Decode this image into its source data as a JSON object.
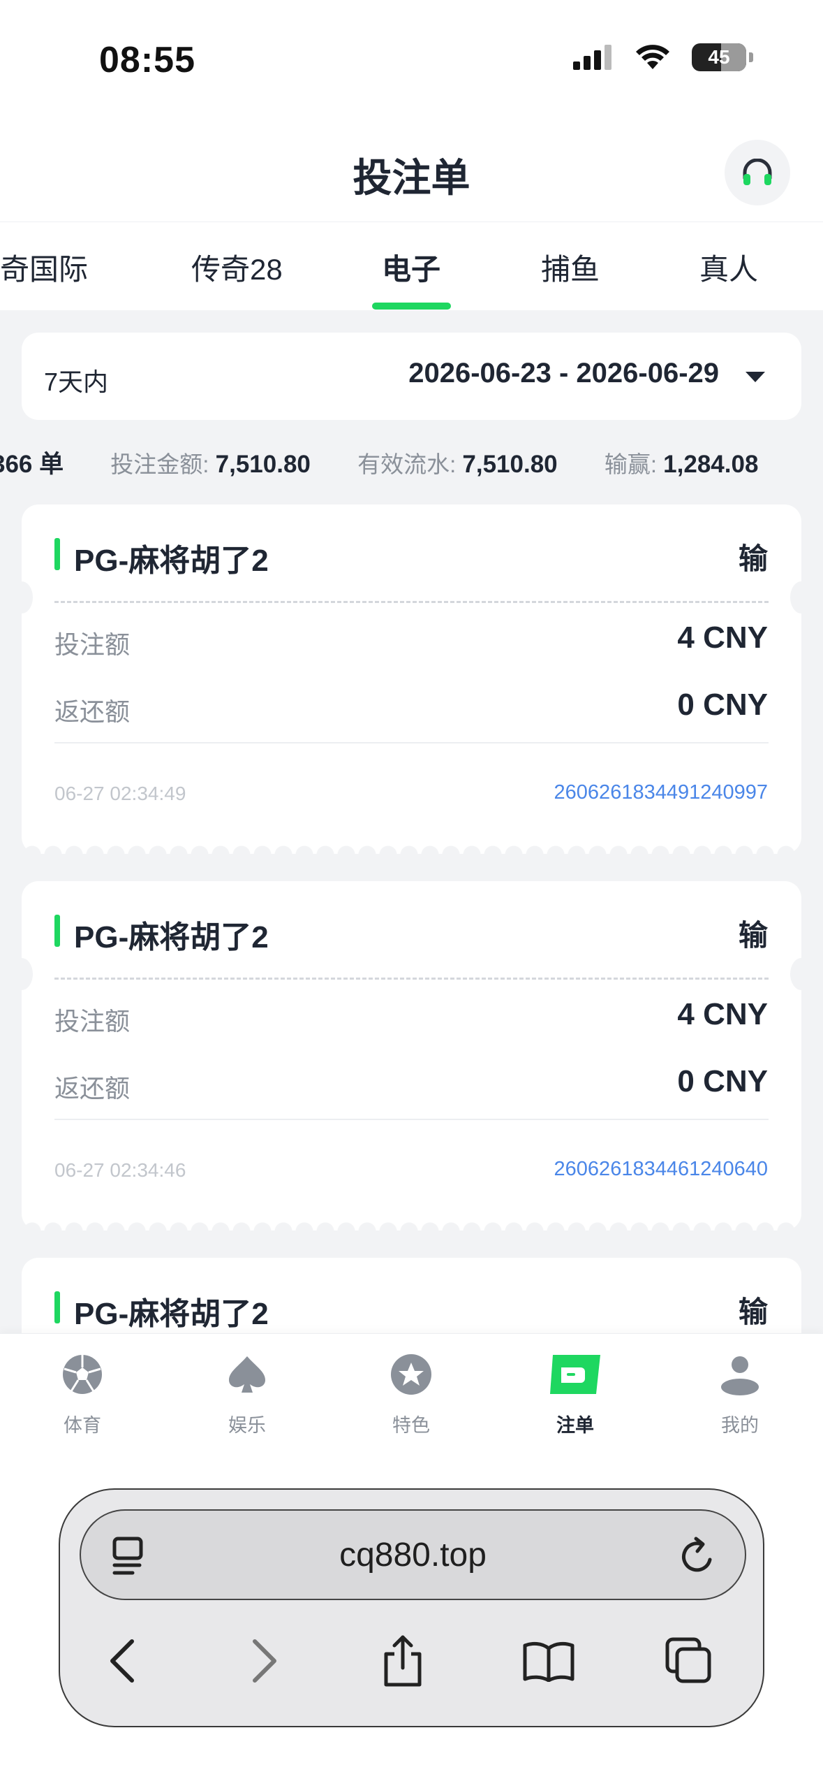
{
  "status": {
    "time": "08:55",
    "battery": "45"
  },
  "header": {
    "title": "投注单"
  },
  "tabs": [
    {
      "label": "奇国际"
    },
    {
      "label": "传奇28"
    },
    {
      "label": "电子",
      "active": true
    },
    {
      "label": "捕鱼"
    },
    {
      "label": "真人"
    }
  ],
  "filter": {
    "range_label": "7天内",
    "range_value": "2026-06-23 - 2026-06-29"
  },
  "summary": {
    "orders": "366 单",
    "bet_label": "投注金额:",
    "bet_value": "7,510.80",
    "turnover_label": "有效流水:",
    "turnover_value": "7,510.80",
    "winloss_label": "输赢:",
    "winloss_value": "1,284.08"
  },
  "bets": [
    {
      "title": "PG-麻将胡了2",
      "result": "输",
      "stake_label": "投注额",
      "stake": "4 CNY",
      "return_label": "返还额",
      "return": "0 CNY",
      "time": "06-27 02:34:49",
      "id": "2606261834491240997"
    },
    {
      "title": "PG-麻将胡了2",
      "result": "输",
      "stake_label": "投注额",
      "stake": "4 CNY",
      "return_label": "返还额",
      "return": "0 CNY",
      "time": "06-27 02:34:46",
      "id": "2606261834461240640"
    },
    {
      "title": "PG-麻将胡了2",
      "result": "输"
    }
  ],
  "nav": [
    {
      "label": "体育",
      "icon": "soccer-ball-icon"
    },
    {
      "label": "娱乐",
      "icon": "spade-icon"
    },
    {
      "label": "特色",
      "icon": "star-icon"
    },
    {
      "label": "注单",
      "icon": "ticket-icon",
      "active": true
    },
    {
      "label": "我的",
      "icon": "user-icon"
    }
  ],
  "browser": {
    "url": "cq880.top"
  },
  "colors": {
    "accent": "#1ed760",
    "link": "#4a86e8",
    "text": "#1f2633",
    "muted": "#8a9099"
  }
}
